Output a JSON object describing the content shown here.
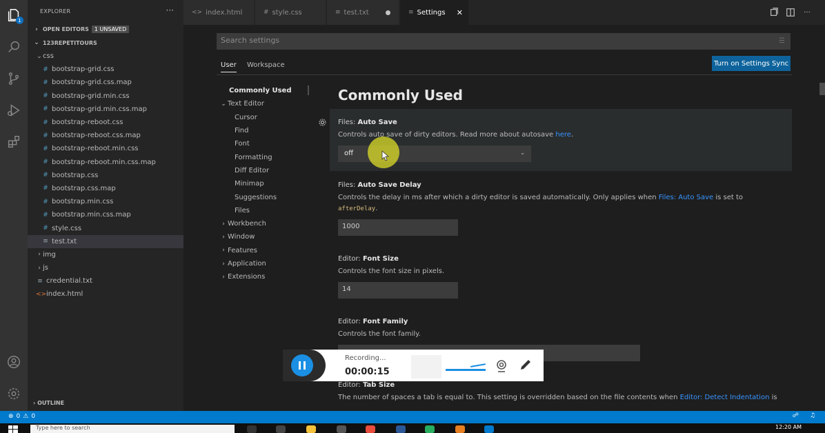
{
  "activity_bar": {
    "explorer_badge": "1",
    "icons": [
      "files-icon",
      "search-icon",
      "source-control-icon",
      "run-debug-icon",
      "extensions-icon",
      "account-icon",
      "manage-gear-icon"
    ]
  },
  "sidebar": {
    "title": "EXPLORER",
    "more": "···",
    "open_editors": "OPEN EDITORS",
    "unsaved": "1 UNSAVED",
    "folder": "123REPETITOURS",
    "outline": "OUTLINE",
    "tree": [
      {
        "label": "css",
        "type": "folder-open",
        "indent": 1
      },
      {
        "label": "bootstrap-grid.css",
        "type": "css",
        "indent": 2
      },
      {
        "label": "bootstrap-grid.css.map",
        "type": "css",
        "indent": 2
      },
      {
        "label": "bootstrap-grid.min.css",
        "type": "css",
        "indent": 2
      },
      {
        "label": "bootstrap-grid.min.css.map",
        "type": "css",
        "indent": 2
      },
      {
        "label": "bootstrap-reboot.css",
        "type": "css",
        "indent": 2
      },
      {
        "label": "bootstrap-reboot.css.map",
        "type": "css",
        "indent": 2
      },
      {
        "label": "bootstrap-reboot.min.css",
        "type": "css",
        "indent": 2
      },
      {
        "label": "bootstrap-reboot.min.css.map",
        "type": "css",
        "indent": 2
      },
      {
        "label": "bootstrap.css",
        "type": "css",
        "indent": 2
      },
      {
        "label": "bootstrap.css.map",
        "type": "css",
        "indent": 2
      },
      {
        "label": "bootstrap.min.css",
        "type": "css",
        "indent": 2
      },
      {
        "label": "bootstrap.min.css.map",
        "type": "css",
        "indent": 2
      },
      {
        "label": "style.css",
        "type": "css",
        "indent": 2
      },
      {
        "label": "test.txt",
        "type": "txt",
        "indent": 2,
        "selected": true
      },
      {
        "label": "img",
        "type": "folder",
        "indent": 1
      },
      {
        "label": "js",
        "type": "folder",
        "indent": 1
      },
      {
        "label": "credential.txt",
        "type": "txt",
        "indent": 1
      },
      {
        "label": "index.html",
        "type": "html",
        "indent": 1
      }
    ]
  },
  "tabs": [
    {
      "label": "index.html",
      "icon": "html-file-icon",
      "glyph": "<>"
    },
    {
      "label": "style.css",
      "icon": "css-file-icon",
      "glyph": "#"
    },
    {
      "label": "test.txt",
      "icon": "text-file-icon",
      "glyph": "≡",
      "dirty": true
    },
    {
      "label": "Settings",
      "icon": "settings-file-icon",
      "glyph": "≡",
      "active": true
    }
  ],
  "settings": {
    "search_placeholder": "Search settings",
    "scope_user": "User",
    "scope_workspace": "Workspace",
    "sync_button": "Turn on Settings Sync",
    "toc": [
      {
        "label": "Commonly Used",
        "level": 0,
        "bold": true
      },
      {
        "label": "Text Editor",
        "level": 0,
        "chevron": "⌄"
      },
      {
        "label": "Cursor",
        "level": 1
      },
      {
        "label": "Find",
        "level": 1
      },
      {
        "label": "Font",
        "level": 1
      },
      {
        "label": "Formatting",
        "level": 1
      },
      {
        "label": "Diff Editor",
        "level": 1
      },
      {
        "label": "Minimap",
        "level": 1
      },
      {
        "label": "Suggestions",
        "level": 1
      },
      {
        "label": "Files",
        "level": 1
      },
      {
        "label": "Workbench",
        "level": 0,
        "chevron": "›"
      },
      {
        "label": "Window",
        "level": 0,
        "chevron": "›"
      },
      {
        "label": "Features",
        "level": 0,
        "chevron": "›"
      },
      {
        "label": "Application",
        "level": 0,
        "chevron": "›"
      },
      {
        "label": "Extensions",
        "level": 0,
        "chevron": "›"
      }
    ],
    "group_title": "Commonly Used",
    "auto_save": {
      "category": "Files: ",
      "name": "Auto Save",
      "desc_before": "Controls auto save of dirty editors. Read more about autosave ",
      "desc_link": "here",
      "desc_after": ".",
      "value": "off"
    },
    "auto_save_delay": {
      "category": "Files: ",
      "name": "Auto Save Delay",
      "desc_before": "Controls the delay in ms after which a dirty editor is saved automatically. Only applies when ",
      "desc_link": "Files: Auto Save",
      "desc_after": " is set to",
      "desc_code": "afterDelay",
      "desc_end": ".",
      "value": "1000"
    },
    "font_size": {
      "category": "Editor: ",
      "name": "Font Size",
      "desc": "Controls the font size in pixels.",
      "value": "14"
    },
    "font_family": {
      "category": "Editor: ",
      "name": "Font Family",
      "desc": "Controls the font family."
    },
    "tab_size": {
      "category": "Editor: ",
      "name": "Tab Size",
      "desc_before": "The number of spaces a tab is equal to. This setting is overridden based on the file contents when ",
      "desc_link": "Editor: Detect Indentation",
      "desc_after": " is"
    }
  },
  "recorder": {
    "label": "Recording...",
    "time": "00:00:15"
  },
  "statusbar": {
    "errors": "0",
    "warnings": "0"
  },
  "taskbar": {
    "search_placeholder": "Type here to search",
    "clock": "12:20 AM"
  },
  "colors": {
    "accent": "#007acc",
    "sync_button": "#0e639c",
    "link": "#3794ff",
    "cursor_highlight": "#dcdc28"
  }
}
